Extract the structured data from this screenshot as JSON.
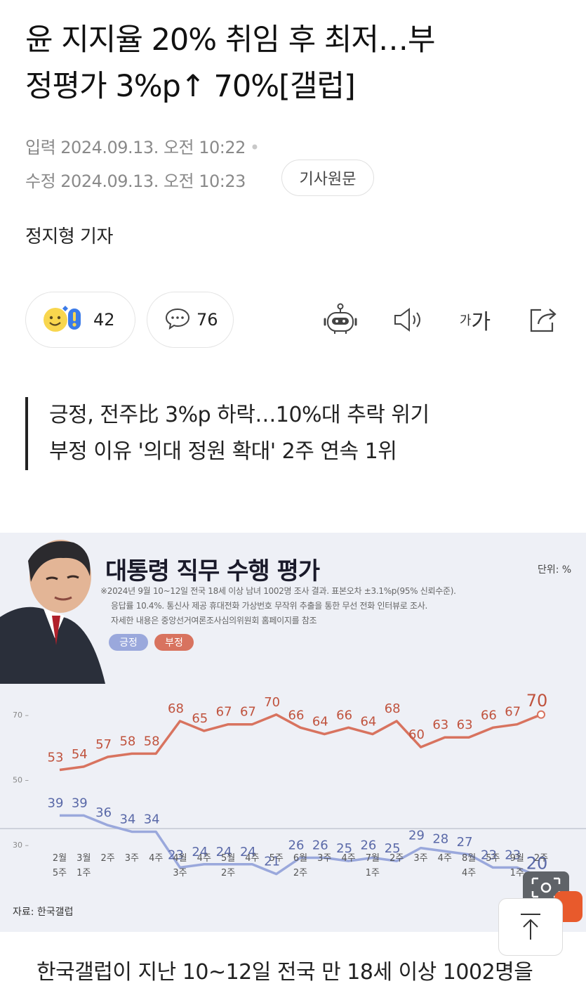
{
  "article": {
    "title_line1": "윤 지지율 20% 취임 후 최저…부",
    "title_line2": "정평가 3%p↑ 70%[갤럽]",
    "input_label": "입력 2024.09.13. 오전 10:22",
    "modified_label": "수정 2024.09.13. 오전 10:23",
    "original_button": "기사원문",
    "reporter": "정지형 기자",
    "subhead_1": "긍정, 전주比 3%p 하락…10%대 추락 위기",
    "subhead_2": "부정 이유 '의대 정원 확대' 2주 연속 1위",
    "body_first_line": "한국갤럽이 지난 10~12일 전국 만 18세 이상 1002명을"
  },
  "toolbar": {
    "reaction_count": "42",
    "comment_count": "76",
    "font_size_label_small": "가",
    "font_size_label_large": "가"
  },
  "graphic": {
    "title": "대통령 직무 수행 평가",
    "unit": "단위: %",
    "note_1": "※2024년 9월 10~12일 전국 18세 이상 남녀 1002명 조사 결과. 표본오차 ±3.1%p(95% 신뢰수준).",
    "note_2": "응답률 10.4%. 통신사 제공 휴대전화 가상번호 무작위 추출을 통한 무선 전화 인터뷰로 조사.",
    "note_3": "자세한 내용은 중앙선거여론조사심의위원회 홈페이지를 참조",
    "legend_positive": "긍정",
    "legend_negative": "부정",
    "source": "자료: 한국갤럽",
    "colors": {
      "positive": "#9aa8dc",
      "negative": "#d8735f",
      "background": "#eef0f6"
    }
  },
  "chart_data": {
    "type": "line",
    "title": "대통령 직무 수행 평가",
    "ylabel": "",
    "ylim": [
      15,
      75
    ],
    "yticks": [
      30,
      50,
      70
    ],
    "categories": [
      "2월\n5주",
      "3월\n1주",
      "2주",
      "3주",
      "4주",
      "4월\n3주",
      "4주",
      "5월\n2주",
      "4주",
      "5주",
      "6월\n2주",
      "3주",
      "4주",
      "7월\n1주",
      "2주",
      "3주",
      "4주",
      "8월\n4주",
      "5주",
      "9월\n1주",
      "2주"
    ],
    "series": [
      {
        "name": "긍정",
        "color": "#9aa8dc",
        "values": [
          39,
          39,
          36,
          34,
          34,
          23,
          24,
          24,
          24,
          21,
          26,
          26,
          25,
          26,
          25,
          29,
          28,
          27,
          23,
          23,
          20
        ]
      },
      {
        "name": "부정",
        "color": "#d8735f",
        "values": [
          53,
          54,
          57,
          58,
          58,
          68,
          65,
          67,
          67,
          70,
          66,
          64,
          66,
          64,
          68,
          60,
          63,
          63,
          66,
          67,
          70
        ]
      }
    ]
  },
  "nav": {
    "scroll_top_icon": "arrow-up-icon"
  }
}
